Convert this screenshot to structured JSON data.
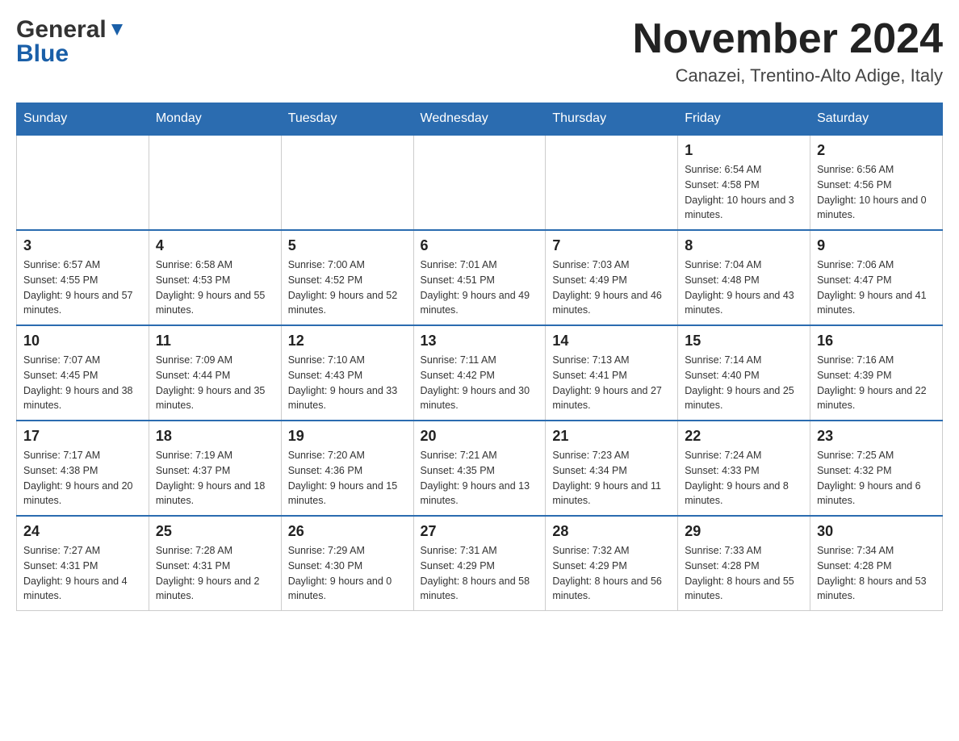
{
  "header": {
    "logo_general": "General",
    "logo_blue": "Blue",
    "month_title": "November 2024",
    "location": "Canazei, Trentino-Alto Adige, Italy"
  },
  "days_of_week": [
    "Sunday",
    "Monday",
    "Tuesday",
    "Wednesday",
    "Thursday",
    "Friday",
    "Saturday"
  ],
  "weeks": [
    {
      "days": [
        {
          "number": "",
          "sunrise": "",
          "sunset": "",
          "daylight": ""
        },
        {
          "number": "",
          "sunrise": "",
          "sunset": "",
          "daylight": ""
        },
        {
          "number": "",
          "sunrise": "",
          "sunset": "",
          "daylight": ""
        },
        {
          "number": "",
          "sunrise": "",
          "sunset": "",
          "daylight": ""
        },
        {
          "number": "",
          "sunrise": "",
          "sunset": "",
          "daylight": ""
        },
        {
          "number": "1",
          "sunrise": "Sunrise: 6:54 AM",
          "sunset": "Sunset: 4:58 PM",
          "daylight": "Daylight: 10 hours and 3 minutes."
        },
        {
          "number": "2",
          "sunrise": "Sunrise: 6:56 AM",
          "sunset": "Sunset: 4:56 PM",
          "daylight": "Daylight: 10 hours and 0 minutes."
        }
      ]
    },
    {
      "days": [
        {
          "number": "3",
          "sunrise": "Sunrise: 6:57 AM",
          "sunset": "Sunset: 4:55 PM",
          "daylight": "Daylight: 9 hours and 57 minutes."
        },
        {
          "number": "4",
          "sunrise": "Sunrise: 6:58 AM",
          "sunset": "Sunset: 4:53 PM",
          "daylight": "Daylight: 9 hours and 55 minutes."
        },
        {
          "number": "5",
          "sunrise": "Sunrise: 7:00 AM",
          "sunset": "Sunset: 4:52 PM",
          "daylight": "Daylight: 9 hours and 52 minutes."
        },
        {
          "number": "6",
          "sunrise": "Sunrise: 7:01 AM",
          "sunset": "Sunset: 4:51 PM",
          "daylight": "Daylight: 9 hours and 49 minutes."
        },
        {
          "number": "7",
          "sunrise": "Sunrise: 7:03 AM",
          "sunset": "Sunset: 4:49 PM",
          "daylight": "Daylight: 9 hours and 46 minutes."
        },
        {
          "number": "8",
          "sunrise": "Sunrise: 7:04 AM",
          "sunset": "Sunset: 4:48 PM",
          "daylight": "Daylight: 9 hours and 43 minutes."
        },
        {
          "number": "9",
          "sunrise": "Sunrise: 7:06 AM",
          "sunset": "Sunset: 4:47 PM",
          "daylight": "Daylight: 9 hours and 41 minutes."
        }
      ]
    },
    {
      "days": [
        {
          "number": "10",
          "sunrise": "Sunrise: 7:07 AM",
          "sunset": "Sunset: 4:45 PM",
          "daylight": "Daylight: 9 hours and 38 minutes."
        },
        {
          "number": "11",
          "sunrise": "Sunrise: 7:09 AM",
          "sunset": "Sunset: 4:44 PM",
          "daylight": "Daylight: 9 hours and 35 minutes."
        },
        {
          "number": "12",
          "sunrise": "Sunrise: 7:10 AM",
          "sunset": "Sunset: 4:43 PM",
          "daylight": "Daylight: 9 hours and 33 minutes."
        },
        {
          "number": "13",
          "sunrise": "Sunrise: 7:11 AM",
          "sunset": "Sunset: 4:42 PM",
          "daylight": "Daylight: 9 hours and 30 minutes."
        },
        {
          "number": "14",
          "sunrise": "Sunrise: 7:13 AM",
          "sunset": "Sunset: 4:41 PM",
          "daylight": "Daylight: 9 hours and 27 minutes."
        },
        {
          "number": "15",
          "sunrise": "Sunrise: 7:14 AM",
          "sunset": "Sunset: 4:40 PM",
          "daylight": "Daylight: 9 hours and 25 minutes."
        },
        {
          "number": "16",
          "sunrise": "Sunrise: 7:16 AM",
          "sunset": "Sunset: 4:39 PM",
          "daylight": "Daylight: 9 hours and 22 minutes."
        }
      ]
    },
    {
      "days": [
        {
          "number": "17",
          "sunrise": "Sunrise: 7:17 AM",
          "sunset": "Sunset: 4:38 PM",
          "daylight": "Daylight: 9 hours and 20 minutes."
        },
        {
          "number": "18",
          "sunrise": "Sunrise: 7:19 AM",
          "sunset": "Sunset: 4:37 PM",
          "daylight": "Daylight: 9 hours and 18 minutes."
        },
        {
          "number": "19",
          "sunrise": "Sunrise: 7:20 AM",
          "sunset": "Sunset: 4:36 PM",
          "daylight": "Daylight: 9 hours and 15 minutes."
        },
        {
          "number": "20",
          "sunrise": "Sunrise: 7:21 AM",
          "sunset": "Sunset: 4:35 PM",
          "daylight": "Daylight: 9 hours and 13 minutes."
        },
        {
          "number": "21",
          "sunrise": "Sunrise: 7:23 AM",
          "sunset": "Sunset: 4:34 PM",
          "daylight": "Daylight: 9 hours and 11 minutes."
        },
        {
          "number": "22",
          "sunrise": "Sunrise: 7:24 AM",
          "sunset": "Sunset: 4:33 PM",
          "daylight": "Daylight: 9 hours and 8 minutes."
        },
        {
          "number": "23",
          "sunrise": "Sunrise: 7:25 AM",
          "sunset": "Sunset: 4:32 PM",
          "daylight": "Daylight: 9 hours and 6 minutes."
        }
      ]
    },
    {
      "days": [
        {
          "number": "24",
          "sunrise": "Sunrise: 7:27 AM",
          "sunset": "Sunset: 4:31 PM",
          "daylight": "Daylight: 9 hours and 4 minutes."
        },
        {
          "number": "25",
          "sunrise": "Sunrise: 7:28 AM",
          "sunset": "Sunset: 4:31 PM",
          "daylight": "Daylight: 9 hours and 2 minutes."
        },
        {
          "number": "26",
          "sunrise": "Sunrise: 7:29 AM",
          "sunset": "Sunset: 4:30 PM",
          "daylight": "Daylight: 9 hours and 0 minutes."
        },
        {
          "number": "27",
          "sunrise": "Sunrise: 7:31 AM",
          "sunset": "Sunset: 4:29 PM",
          "daylight": "Daylight: 8 hours and 58 minutes."
        },
        {
          "number": "28",
          "sunrise": "Sunrise: 7:32 AM",
          "sunset": "Sunset: 4:29 PM",
          "daylight": "Daylight: 8 hours and 56 minutes."
        },
        {
          "number": "29",
          "sunrise": "Sunrise: 7:33 AM",
          "sunset": "Sunset: 4:28 PM",
          "daylight": "Daylight: 8 hours and 55 minutes."
        },
        {
          "number": "30",
          "sunrise": "Sunrise: 7:34 AM",
          "sunset": "Sunset: 4:28 PM",
          "daylight": "Daylight: 8 hours and 53 minutes."
        }
      ]
    }
  ]
}
